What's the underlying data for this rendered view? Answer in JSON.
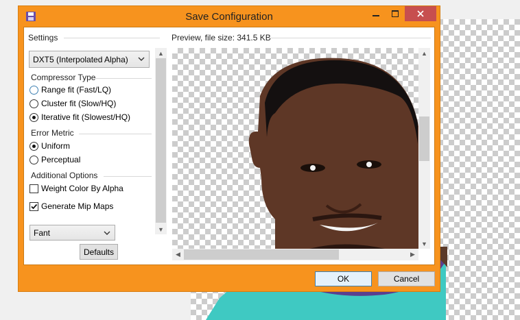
{
  "dialog": {
    "title": "Save Configuration",
    "title_icon": "floppy-disk-icon",
    "window_controls": [
      "minimize-icon",
      "maximize-icon",
      "close-icon"
    ]
  },
  "settings": {
    "label": "Settings",
    "format": "DXT5 (Interpolated Alpha)",
    "compressor_type": {
      "label": "Compressor Type",
      "options": [
        {
          "label": "Range fit (Fast/LQ)",
          "selected": false
        },
        {
          "label": "Cluster fit (Slow/HQ)",
          "selected": false
        },
        {
          "label": "Iterative fit (Slowest/HQ)",
          "selected": true
        }
      ]
    },
    "error_metric": {
      "label": "Error Metric",
      "options": [
        {
          "label": "Uniform",
          "selected": true
        },
        {
          "label": "Perceptual",
          "selected": false
        }
      ]
    },
    "additional_options": {
      "label": "Additional Options",
      "weight_color_by_alpha": {
        "label": "Weight Color By Alpha",
        "checked": false
      },
      "generate_mip_maps": {
        "label": "Generate Mip Maps",
        "checked": true
      }
    },
    "mip_filter": "Fant",
    "defaults_label": "Defaults"
  },
  "preview": {
    "label": "Preview, file size: 341.5 KB"
  },
  "buttons": {
    "ok": "OK",
    "cancel": "Cancel"
  },
  "colors": {
    "dialog_frame": "#f7931e",
    "close_button": "#c74f4f",
    "jersey": "#3fc9c2",
    "collar": "#5a3f8f"
  }
}
